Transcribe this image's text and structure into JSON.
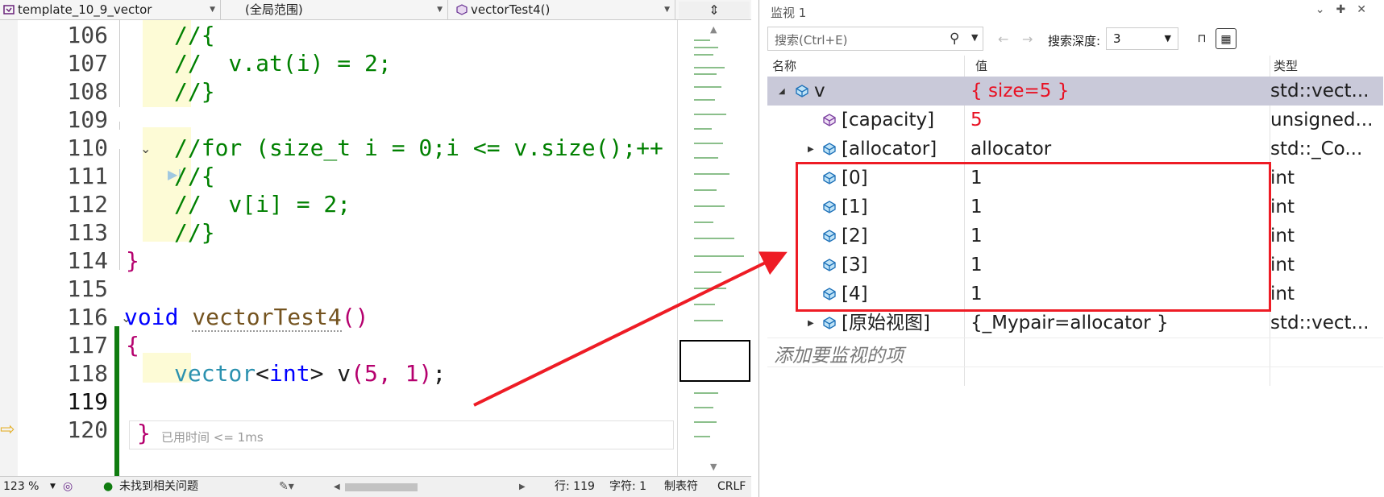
{
  "editor": {
    "nav": {
      "project": "template_10_9_vector",
      "scope": "(全局范围)",
      "member": "vectorTest4()"
    },
    "lines": [
      {
        "num": "106",
        "text": "//{"
      },
      {
        "num": "107",
        "text": "//  v.at(i) = 2;"
      },
      {
        "num": "108",
        "text": "//}"
      },
      {
        "num": "109",
        "text": ""
      },
      {
        "num": "110",
        "text": "//for (size_t i = 0;i <= v.size();++"
      },
      {
        "num": "111",
        "text": "//{"
      },
      {
        "num": "112",
        "text": "//  v[i] = 2;"
      },
      {
        "num": "113",
        "text": "//}"
      },
      {
        "num": "114",
        "text": "}"
      },
      {
        "num": "115",
        "text": ""
      },
      {
        "num": "116",
        "text": "void vectorTest4()"
      },
      {
        "num": "117",
        "text": "{"
      },
      {
        "num": "118",
        "text": "vector<int> v(5, 1);"
      },
      {
        "num": "119",
        "text": "}"
      },
      {
        "num": "120",
        "text": ""
      }
    ],
    "code_tokens": {
      "l116_void": "void",
      "l116_fn": "vectorTest4",
      "l116_parens": "()",
      "l118_type": "vector",
      "l118_lt": "<",
      "l118_int": "int",
      "l118_rest": "> v",
      "l118_args": "(5, 1)",
      "l118_semi": ";"
    },
    "elapsed_hint": "已用时间 <= 1ms",
    "status": {
      "zoom": "123 %",
      "issues": "未找到相关问题",
      "line": "行: 119",
      "char": "字符: 1",
      "tab": "制表符",
      "eol": "CRLF"
    }
  },
  "watch": {
    "title": "监视 1",
    "search_placeholder": "搜索(Ctrl+E)",
    "depth_label": "搜索深度:",
    "depth_value": "3",
    "columns": {
      "name": "名称",
      "value": "值",
      "type": "类型"
    },
    "rows": [
      {
        "name": "v",
        "value": "{ size=5 }",
        "type": "std::vect..."
      },
      {
        "name": "[capacity]",
        "value": "5",
        "type": "unsigned..."
      },
      {
        "name": "[allocator]",
        "value": "allocator",
        "type": "std::_Co..."
      },
      {
        "name": "[0]",
        "value": "1",
        "type": "int"
      },
      {
        "name": "[1]",
        "value": "1",
        "type": "int"
      },
      {
        "name": "[2]",
        "value": "1",
        "type": "int"
      },
      {
        "name": "[3]",
        "value": "1",
        "type": "int"
      },
      {
        "name": "[4]",
        "value": "1",
        "type": "int"
      },
      {
        "name": "[原始视图]",
        "value": "{_Mypair=allocator }",
        "type": "std::vect..."
      }
    ],
    "add_placeholder": "添加要监视的项"
  },
  "colors": {
    "comment": "#008000",
    "keyword": "#0000ff",
    "changed_value": "#e81123",
    "annotation": "#ee1c25",
    "selected_row": "#c9c9d9"
  }
}
